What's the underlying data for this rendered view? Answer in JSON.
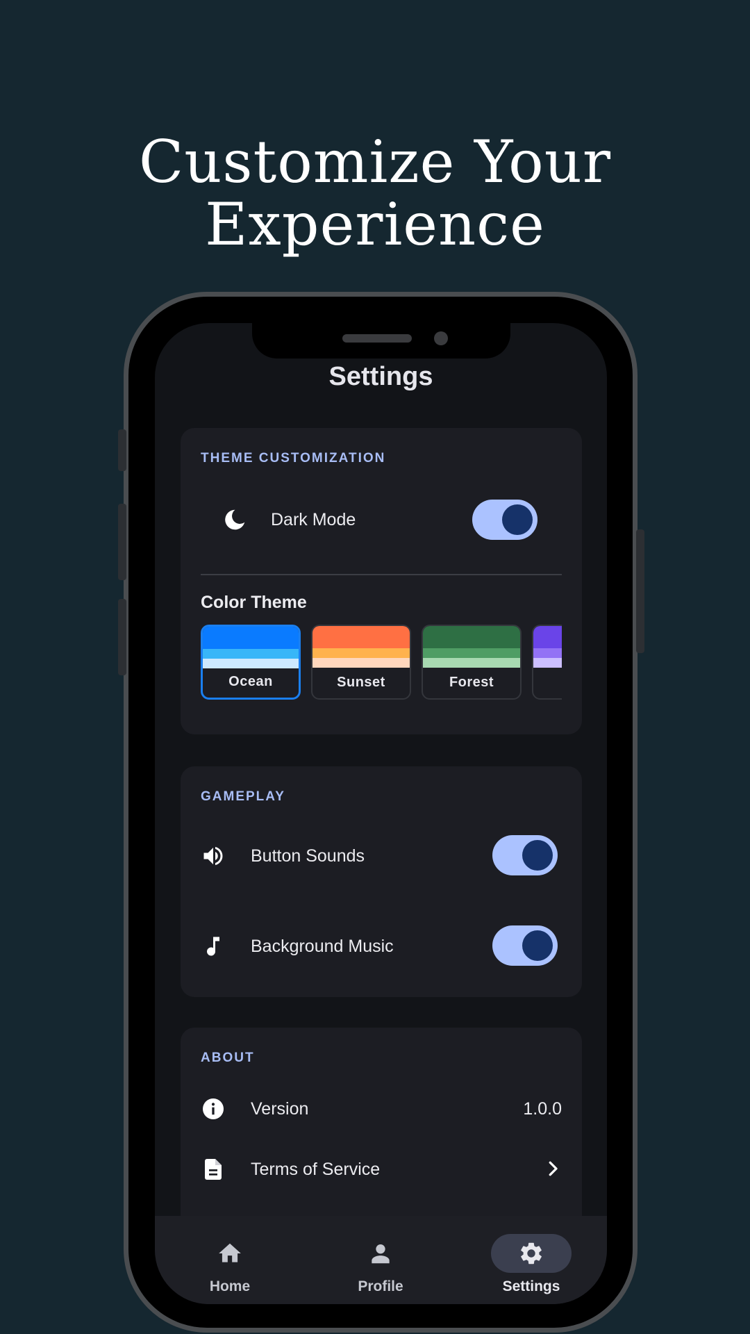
{
  "headline": {
    "line1": "Customize Your",
    "line2": "Experience"
  },
  "screen": {
    "title": "Settings"
  },
  "theme": {
    "header": "THEME CUSTOMIZATION",
    "dark_mode": {
      "label": "Dark Mode",
      "icon": "moon-icon",
      "on": true
    },
    "color_theme_title": "Color Theme",
    "themes": [
      {
        "name": "Ocean",
        "colors": [
          "#0a7bff",
          "#38b6f8",
          "#cde9ff"
        ],
        "selected": true
      },
      {
        "name": "Sunset",
        "colors": [
          "#ff7043",
          "#ffb24d",
          "#ffd7bd"
        ],
        "selected": false
      },
      {
        "name": "Forest",
        "colors": [
          "#2e6f44",
          "#4f9d64",
          "#a8d9b1"
        ],
        "selected": false
      },
      {
        "name": "",
        "colors": [
          "#6a44e8",
          "#9372f5",
          "#ccbfff"
        ],
        "selected": false
      }
    ]
  },
  "gameplay": {
    "header": "GAMEPLAY",
    "button_sounds": {
      "label": "Button Sounds",
      "icon": "speaker-icon",
      "on": true
    },
    "background_music": {
      "label": "Background Music",
      "icon": "music-note-icon",
      "on": true
    }
  },
  "about": {
    "header": "ABOUT",
    "version": {
      "label": "Version",
      "value": "1.0.0",
      "icon": "info-icon"
    },
    "terms": {
      "label": "Terms of Service",
      "icon": "document-icon"
    }
  },
  "nav": {
    "items": [
      {
        "label": "Home",
        "icon": "home-icon",
        "active": false
      },
      {
        "label": "Profile",
        "icon": "person-icon",
        "active": false
      },
      {
        "label": "Settings",
        "icon": "gear-icon",
        "active": true
      }
    ]
  },
  "colors": {
    "accent": "#abc2ff",
    "background": "#152730",
    "surface": "#1c1d23"
  }
}
